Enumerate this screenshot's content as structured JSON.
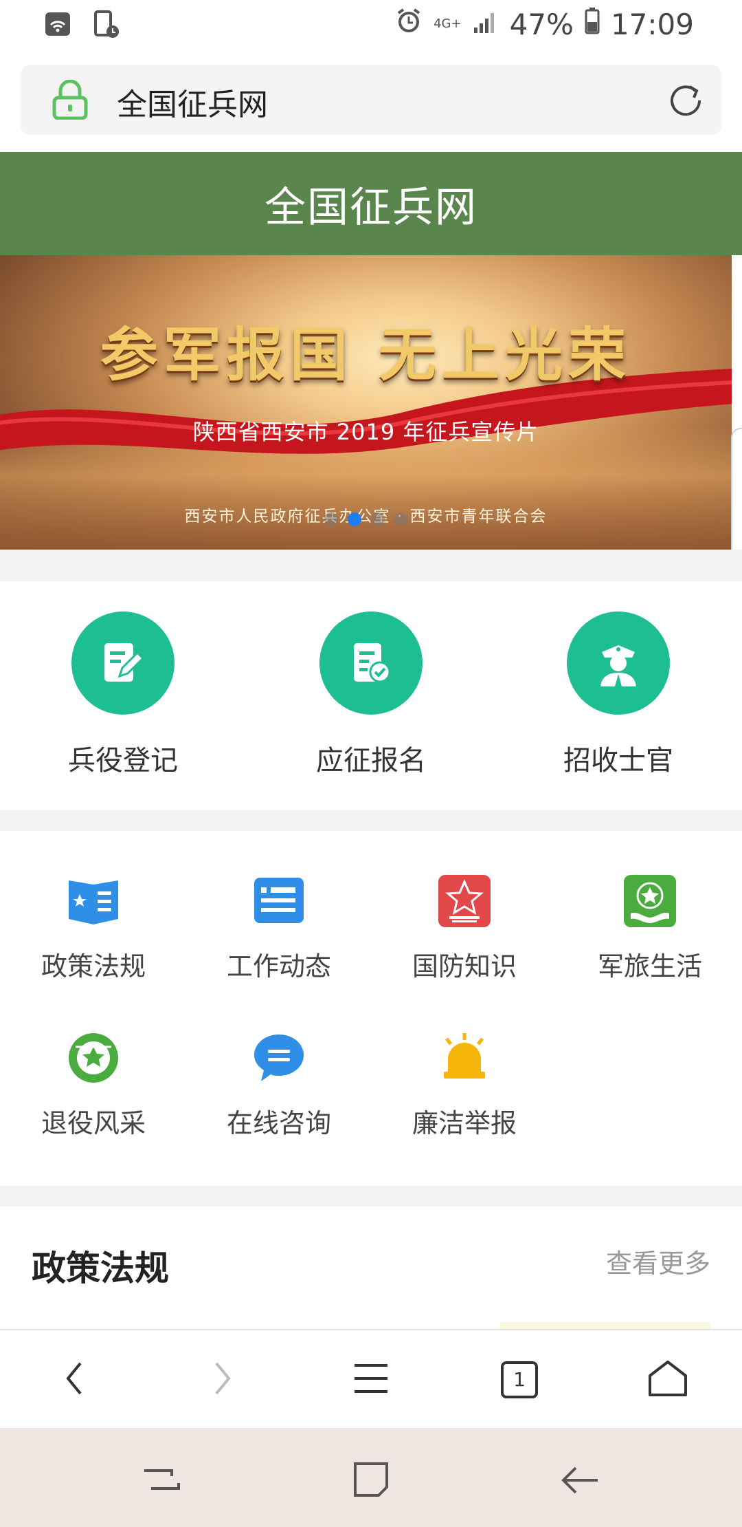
{
  "status_bar": {
    "network_type": "4G+",
    "battery": "47%",
    "time": "17:09"
  },
  "url_bar": {
    "url_text": "全国征兵网"
  },
  "site_header": {
    "title": "全国征兵网"
  },
  "banner": {
    "headline": "参军报国 无上光荣",
    "subtitle": "陕西省西安市 2019 年征兵宣传片",
    "credit": "西安市人民政府征兵办公室 · 西安市青年联合会",
    "slide_count": 4,
    "active_slide": 2
  },
  "main_actions": [
    {
      "label": "兵役登记",
      "icon": "edit-document-icon"
    },
    {
      "label": "应征报名",
      "icon": "document-check-icon"
    },
    {
      "label": "招收士官",
      "icon": "officer-icon"
    }
  ],
  "categories": [
    {
      "label": "政策法规",
      "icon": "policy-book-icon",
      "color": "#2f8fe6"
    },
    {
      "label": "工作动态",
      "icon": "news-card-icon",
      "color": "#2f8fe6"
    },
    {
      "label": "国防知识",
      "icon": "army-star-icon",
      "color": "#e2484a"
    },
    {
      "label": "军旅生活",
      "icon": "star-hand-icon",
      "color": "#4aab3f"
    },
    {
      "label": "退役风采",
      "icon": "veteran-badge-icon",
      "color": "#4aab3f"
    },
    {
      "label": "在线咨询",
      "icon": "chat-bubble-icon",
      "color": "#2f8fe6"
    },
    {
      "label": "廉洁举报",
      "icon": "alarm-light-icon",
      "color": "#f5b50a"
    }
  ],
  "section": {
    "title": "政策法规",
    "more": "查看更多"
  },
  "toolbar": {
    "tab_count": "1"
  },
  "colors": {
    "header_green": "#5a854d",
    "action_teal": "#1dbf92",
    "dot_active": "#1e7df0"
  }
}
